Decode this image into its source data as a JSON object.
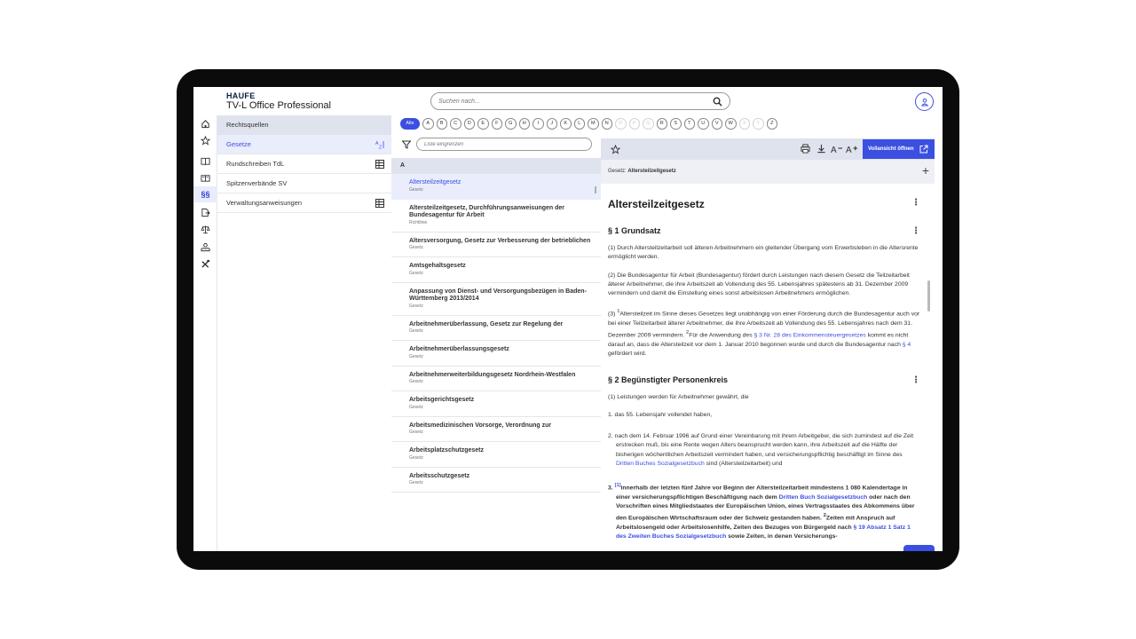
{
  "header": {
    "logo": "HAUFE",
    "app_name": "TV-L Office Professional",
    "search_placeholder": "Suchen nach..."
  },
  "rail": {
    "items": [
      {
        "name": "home-icon"
      },
      {
        "name": "star-icon"
      },
      {
        "name": "book-icon"
      },
      {
        "name": "books-icon"
      },
      {
        "name": "paragraph-icon",
        "label": "§§"
      },
      {
        "name": "document-arrow-icon"
      },
      {
        "name": "scales-icon"
      },
      {
        "name": "hand-icon"
      },
      {
        "name": "tools-icon"
      }
    ]
  },
  "sources": {
    "header": "Rechtsquellen",
    "items": [
      {
        "label": "Gesetze",
        "icon": "sort-az-icon",
        "active": true
      },
      {
        "label": "Rundschreiben TdL",
        "icon": "table-icon"
      },
      {
        "label": "Spitzenverbände SV",
        "icon": ""
      },
      {
        "label": "Verwaltungsanweisungen",
        "icon": "table-icon"
      }
    ]
  },
  "alphabet": {
    "all_label": "Alle",
    "letters": [
      "A",
      "B",
      "C",
      "D",
      "E",
      "F",
      "G",
      "H",
      "I",
      "J",
      "K",
      "L",
      "M",
      "N",
      "O",
      "P",
      "Q",
      "R",
      "S",
      "T",
      "U",
      "V",
      "W",
      "X",
      "Y",
      "Z"
    ],
    "disabled": [
      "O",
      "P",
      "Q",
      "X",
      "Y"
    ]
  },
  "filter": {
    "placeholder": "Liste eingrenzen"
  },
  "list": {
    "letter_header": "A",
    "items": [
      {
        "title": "Altersteilzeitgesetz",
        "type": "Gesetz",
        "active": true
      },
      {
        "title": "Altersteilzeitgesetz, Durchführungsanweisungen der Bundesagentur für Arbeit",
        "type": "Richtlinie"
      },
      {
        "title": "Altersversorgung, Gesetz zur Verbesserung der betrieblichen",
        "type": "Gesetz"
      },
      {
        "title": "Amtsgehaltsgesetz",
        "type": "Gesetz"
      },
      {
        "title": "Anpassung von Dienst- und Versorgungsbezügen in Baden-Württemberg 2013/2014",
        "type": "Gesetz"
      },
      {
        "title": "Arbeitnehmerüberlassung, Gesetz zur Regelung der",
        "type": "Gesetz"
      },
      {
        "title": "Arbeitnehmerüberlassungsgesetz",
        "type": "Gesetz"
      },
      {
        "title": "Arbeitnehmerweiterbildungsgesetz Nordrhein-Westfalen",
        "type": "Gesetz"
      },
      {
        "title": "Arbeitsgerichtsgesetz",
        "type": "Gesetz"
      },
      {
        "title": "Arbeitsmedizinischen Vorsorge, Verordnung zur",
        "type": "Gesetz"
      },
      {
        "title": "Arbeitsplatzschutzgesetz",
        "type": "Gesetz"
      },
      {
        "title": "Arbeitsschutzgesetz",
        "type": "Gesetz"
      }
    ]
  },
  "doc": {
    "open_button": "Vollansicht öffnen",
    "breadcrumb_prefix": "Gesetz:",
    "breadcrumb_title": "Altersteilzeitgesetz",
    "title": "Altersteilzeitgesetz",
    "sec1_title": "§ 1 Grundsatz",
    "sec1_p1": "(1) Durch Altersteilzeitarbeit soll älteren Arbeitnehmern ein gleitender Übergang vom Erwerbsleben in die Altersrente ermöglicht werden.",
    "sec1_p2": "(2) Die Bundesagentur für Arbeit (Bundesagentur) fördert durch Leistungen nach diesem Gesetz die Teilzeitarbeit älterer Arbeitnehmer, die ihre Arbeitszeit ab Vollendung des 55. Lebensjahres spätestens ab 31. Dezember 2009 vermindern und damit die Einstellung eines sonst arbeitslosen Arbeitnehmers ermöglichen.",
    "sec1_p3_a": "(3) ",
    "sec1_p3_sup1": "1",
    "sec1_p3_b": "Altersteilzeit im Sinne dieses Gesetzes liegt unabhängig von einer Förderung durch die Bundesagentur auch vor bei einer Teilzeitarbeit älterer Arbeitnehmer, die ihre Arbeitszeit ab Vollendung des 55. Lebensjahres nach dem 31. Dezember 2009 vermindern. ",
    "sec1_p3_sup2": "2",
    "sec1_p3_c": "Für die Anwendung des ",
    "sec1_p3_link1": "§ 3 Nr. 28 des Einkommensteuergesetzes",
    "sec1_p3_d": " kommt es nicht darauf an, dass die Altersteilzeit vor dem 1. Januar 2010 begonnen wurde und durch die Bundesagentur nach ",
    "sec1_p3_link2": "§ 4",
    "sec1_p3_e": " gefördert wird.",
    "sec2_title": "§ 2 Begünstigter Personenkreis",
    "sec2_p1": "(1) Leistungen werden für Arbeitnehmer gewährt, die",
    "sec2_i1": "1. das 55. Lebensjahr vollendet haben,",
    "sec2_i2_a": "2. nach dem 14. Februar 1996 auf Grund einer Vereinbarung mit ihrem Arbeitgeber, die sich zumindest auf die Zeit erstrecken muß, bis eine Rente wegen Alters beansprucht werden kann, ihre Arbeitszeit auf die Hälfte der bisherigen wöchentlichen Arbeitszeit vermindert haben, und versicherungspflichtig beschäftigt im Sinne des ",
    "sec2_i2_link": "Dritten Buches Sozialgesetzbuch",
    "sec2_i2_b": " sind (Altersteilzeitarbeit) und",
    "sec2_i3_num": "3. ",
    "sec2_i3_sup": "[1]",
    "sec2_i3_a": "innerhalb der letzten fünf Jahre vor Beginn der Altersteilzeitarbeit mindestens 1 080 Kalendertage in einer versicherungspflichtigen Beschäftigung nach dem ",
    "sec2_i3_link1": "Dritten Buch Sozialgesetzbuch",
    "sec2_i3_b": " oder nach den Vorschriften eines Mitgliedstaates der Europäischen Union, eines Vertragsstaates des Abkommens über den Europäischen Wirtschaftsraum oder der Schweiz gestanden haben. ",
    "sec2_i3_sup2": "2",
    "sec2_i3_c": "Zeiten mit Anspruch auf Arbeitslosengeld oder Arbeitslosenhilfe, Zeiten des Bezuges von Bürgergeld nach ",
    "sec2_i3_link2": "§ 19 Absatz 1 Satz 1 des Zweiten Buches Sozialgesetzbuch",
    "sec2_i3_d": " sowie Zeiten, in denen Versicherungs-"
  },
  "colors": {
    "accent": "#3b4fe0",
    "panel_header": "#dfe3ee",
    "active_row": "#e9edfc"
  }
}
